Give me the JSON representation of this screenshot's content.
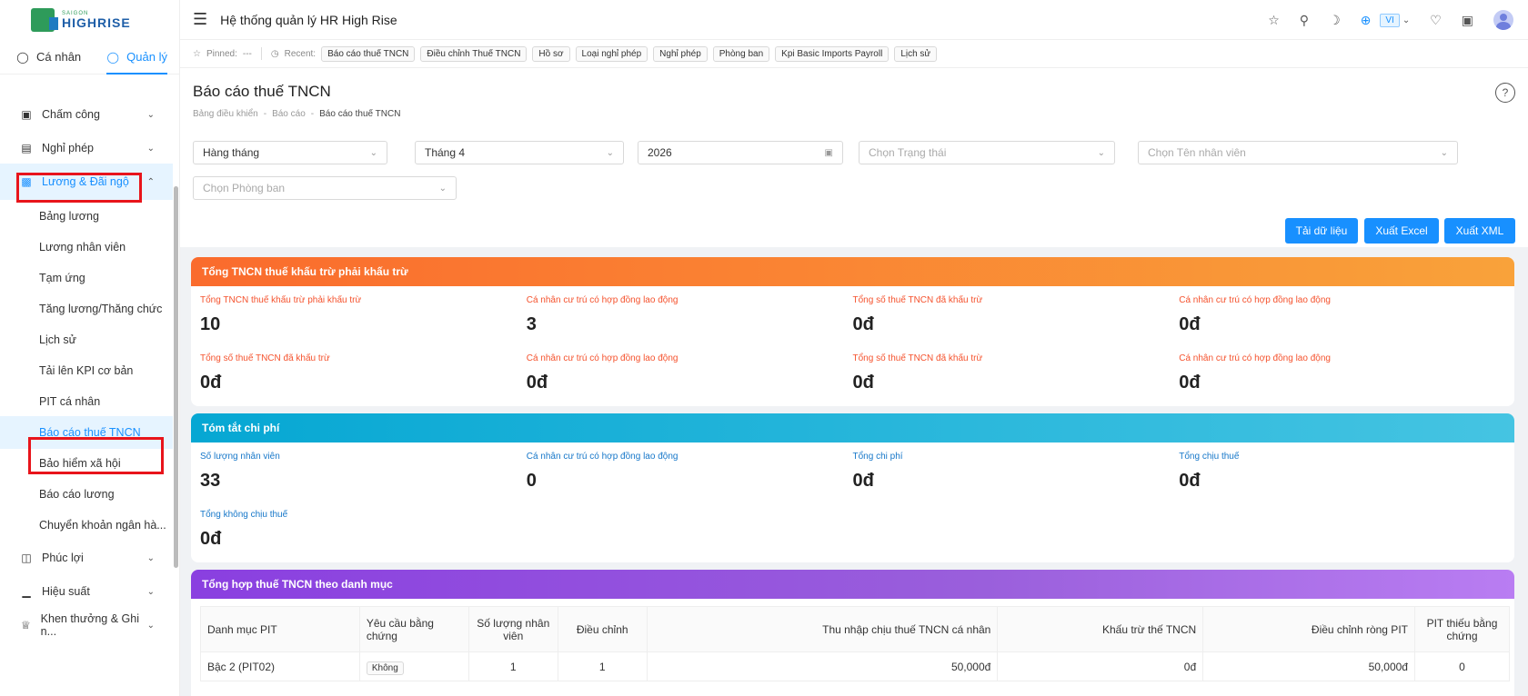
{
  "logo": {
    "top": "SAIGON",
    "bottom": "HIGHRISE"
  },
  "role_tabs": [
    {
      "label": "Cá nhân",
      "icon": "user-icon"
    },
    {
      "label": "Quản lý",
      "icon": "user-icon"
    }
  ],
  "menu": {
    "groups": [
      {
        "label": "Chấm công",
        "icon": "calendar-icon"
      },
      {
        "label": "Nghỉ phép",
        "icon": "car-icon"
      },
      {
        "label": "Lương & Đãi ngộ",
        "icon": "money-icon"
      }
    ],
    "sub_items": [
      "Bảng lương",
      "Lương nhân viên",
      "Tạm ứng",
      "Tăng lương/Thăng chức",
      "Lịch sử",
      "Tải lên KPI cơ bản",
      "PIT cá nhân",
      "Báo cáo thuế TNCN",
      "Bảo hiểm xã hội",
      "Báo cáo lương",
      "Chuyển khoản ngân hà..."
    ],
    "groups_after": [
      {
        "label": "Phúc lợi",
        "icon": "gift-icon"
      },
      {
        "label": "Hiệu suất",
        "icon": "chart-icon"
      },
      {
        "label": "Khen thưởng & Ghi n...",
        "icon": "trophy-icon"
      }
    ]
  },
  "header": {
    "title": "Hệ thống quản lý HR High Rise",
    "lang": "VI"
  },
  "pinbar": {
    "pinned_label": "Pinned:",
    "pinned_value": "---",
    "recent_label": "Recent:",
    "recent": [
      "Báo cáo thuế TNCN",
      "Điều chỉnh Thuế TNCN",
      "Hồ sơ",
      "Loại nghỉ phép",
      "Nghỉ phép",
      "Phòng ban",
      "Kpi Basic Imports Payroll",
      "Lịch sử"
    ]
  },
  "page": {
    "title": "Báo cáo thuế TNCN",
    "breadcrumb": [
      "Bảng điều khiển",
      "Báo cáo",
      "Báo cáo thuế TNCN"
    ]
  },
  "filters": {
    "period": "Hàng tháng",
    "month": "Tháng 4",
    "year": "2026",
    "status_placeholder": "Chọn Trạng thái",
    "employee_placeholder": "Chọn Tên nhân viên",
    "department_placeholder": "Chọn Phòng ban"
  },
  "actions": {
    "load": "Tải dữ liệu",
    "excel": "Xuất Excel",
    "xml": "Xuất XML"
  },
  "card_withholding": {
    "title": "Tổng TNCN thuế khấu trừ phải khấu trừ",
    "stats": [
      {
        "label": "Tổng TNCN thuế khấu trừ phải khấu trừ",
        "value": "10"
      },
      {
        "label": "Cá nhân cư trú có hợp đồng lao động",
        "value": "3"
      },
      {
        "label": "Tổng số thuế TNCN đã khấu trừ",
        "value": "0đ"
      },
      {
        "label": "Cá nhân cư trú có hợp đồng lao động",
        "value": "0đ"
      },
      {
        "label": "Tổng số thuế TNCN đã khấu trừ",
        "value": "0đ"
      },
      {
        "label": "Cá nhân cư trú có hợp đồng lao động",
        "value": "0đ"
      },
      {
        "label": "Tổng số thuế TNCN đã khấu trừ",
        "value": "0đ"
      },
      {
        "label": "Cá nhân cư trú có hợp đồng lao động",
        "value": "0đ"
      }
    ]
  },
  "card_cost": {
    "title": "Tóm tắt chi phí",
    "stats": [
      {
        "label": "Số lượng nhân viên",
        "value": "33"
      },
      {
        "label": "Cá nhân cư trú có hợp đồng lao động",
        "value": "0"
      },
      {
        "label": "Tổng chi phí",
        "value": "0đ"
      },
      {
        "label": "Tổng chịu thuế",
        "value": "0đ"
      },
      {
        "label": "Tổng không chịu thuế",
        "value": "0đ"
      }
    ]
  },
  "card_category": {
    "title": "Tổng hợp thuế TNCN theo danh mục",
    "columns": [
      "Danh mục PIT",
      "Yêu cầu bằng chứng",
      "Số lượng nhân viên",
      "Điều chỉnh",
      "Thu nhập chịu thuế TNCN cá nhân",
      "Khấu trừ thế TNCN",
      "Điều chỉnh ròng PIT",
      "PIT thiếu bằng chứng"
    ],
    "rows": [
      {
        "category": "Bậc 2 (PIT02)",
        "evidence": "Không",
        "employees": "1",
        "adjustment": "1",
        "taxable_income": "50,000đ",
        "deduction": "0đ",
        "net_adjustment": "50,000đ",
        "missing_evidence": "0"
      }
    ]
  },
  "colors": {
    "accent": "#1890ff",
    "orange_gradient": [
      "#fa6b2d",
      "#f9a23a"
    ],
    "teal_gradient": [
      "#06a7d3",
      "#45c4e2"
    ],
    "purple_gradient": [
      "#8a3fe0",
      "#b97df2"
    ],
    "highlight": "#e8141b"
  }
}
